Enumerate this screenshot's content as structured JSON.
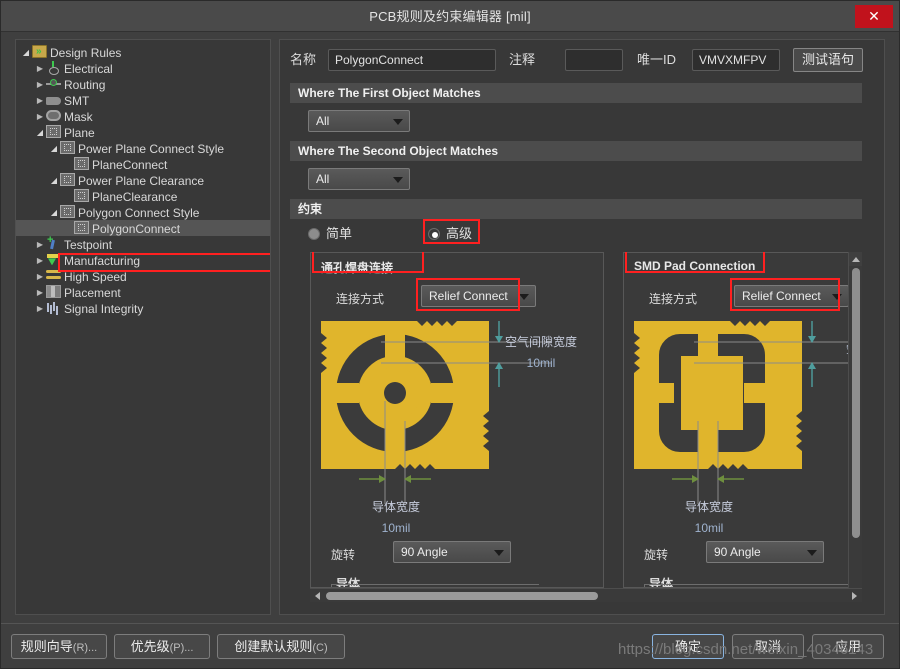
{
  "window": {
    "title": "PCB规则及约束编辑器 [mil]",
    "close_label": "✕"
  },
  "tree": {
    "items": [
      {
        "label": "Design Rules",
        "depth": 0,
        "twisty": "open",
        "icon": "folder-icon",
        "selected": false
      },
      {
        "label": "Electrical",
        "depth": 1,
        "twisty": "closed",
        "icon": "electrical-icon",
        "selected": false
      },
      {
        "label": "Routing",
        "depth": 1,
        "twisty": "closed",
        "icon": "routing-icon",
        "selected": false
      },
      {
        "label": "SMT",
        "depth": 1,
        "twisty": "closed",
        "icon": "smt-icon",
        "selected": false
      },
      {
        "label": "Mask",
        "depth": 1,
        "twisty": "closed",
        "icon": "mask-icon",
        "selected": false
      },
      {
        "label": "Plane",
        "depth": 1,
        "twisty": "open",
        "icon": "plane-icon",
        "selected": false
      },
      {
        "label": "Power Plane Connect Style",
        "depth": 2,
        "twisty": "open",
        "icon": "plane-icon",
        "selected": false
      },
      {
        "label": "PlaneConnect",
        "depth": 3,
        "twisty": "none",
        "icon": "plane-icon",
        "selected": false
      },
      {
        "label": "Power Plane Clearance",
        "depth": 2,
        "twisty": "open",
        "icon": "plane-icon",
        "selected": false
      },
      {
        "label": "PlaneClearance",
        "depth": 3,
        "twisty": "none",
        "icon": "plane-icon",
        "selected": false
      },
      {
        "label": "Polygon Connect Style",
        "depth": 2,
        "twisty": "open",
        "icon": "plane-icon",
        "selected": false
      },
      {
        "label": "PolygonConnect",
        "depth": 3,
        "twisty": "none",
        "icon": "plane-icon",
        "selected": true
      },
      {
        "label": "Testpoint",
        "depth": 1,
        "twisty": "closed",
        "icon": "testpoint-icon",
        "selected": false
      },
      {
        "label": "Manufacturing",
        "depth": 1,
        "twisty": "closed",
        "icon": "manufacturing-icon",
        "selected": false
      },
      {
        "label": "High Speed",
        "depth": 1,
        "twisty": "closed",
        "icon": "highspeed-icon",
        "selected": false
      },
      {
        "label": "Placement",
        "depth": 1,
        "twisty": "closed",
        "icon": "placement-icon",
        "selected": false
      },
      {
        "label": "Signal Integrity",
        "depth": 1,
        "twisty": "closed",
        "icon": "signalintegrity-icon",
        "selected": false
      }
    ]
  },
  "form": {
    "name_label": "名称",
    "name_value": "PolygonConnect",
    "comment_label": "注释",
    "comment_value": "",
    "comment_placeholder": "",
    "uid_label": "唯一ID",
    "uid_value": "VMVXMFPV",
    "test_button": "测试语句"
  },
  "first_match": {
    "header": "Where The First Object Matches",
    "scope_value": "All"
  },
  "second_match": {
    "header": "Where The Second Object Matches",
    "scope_value": "All"
  },
  "constraints": {
    "header": "约束",
    "mode_simple": "简单",
    "mode_advanced": "高级",
    "selected_mode": "高级"
  },
  "through_hole": {
    "title": "通孔焊盘连接",
    "connect_label": "连接方式",
    "connect_value": "Relief Connect",
    "air_gap_label": "空气间隙宽度",
    "air_gap_value": "10mil",
    "conductor_width_label": "导体宽度",
    "conductor_width_value": "10mil",
    "rotation_label": "旋转",
    "rotation_value": "90 Angle",
    "conductors_label": "导体"
  },
  "smd_pad": {
    "title": "SMD Pad Connection",
    "connect_label": "连接方式",
    "connect_value": "Relief Connect",
    "air_gap_label_clipped": "空",
    "conductor_width_label": "导体宽度",
    "conductor_width_value": "10mil",
    "rotation_label": "旋转",
    "rotation_value": "90 Angle",
    "conductors_label": "导体"
  },
  "footer": {
    "wizard_button": "规则向导",
    "wizard_accel": "(R)...",
    "priority_button": "优先级",
    "priority_accel": "(P)...",
    "defaults_button": "创建默认规则",
    "defaults_accel": "(C)",
    "ok_button": "确定",
    "cancel_button": "取消",
    "apply_button": "应用"
  },
  "watermark": {
    "text": "https://blog.csdn.net/weixin_40346143"
  },
  "colors": {
    "pad_gold": "#e0b52c",
    "window_bg": "#3f3f3f",
    "panel_bg": "#383838",
    "section_head": "#4c4c4c",
    "highlight_red": "#ff2020",
    "close_red": "#c1121c",
    "dim_teal": "#4f9e9e",
    "dim_green": "#6e8f3e",
    "dim_text": "#9fb3cf"
  }
}
